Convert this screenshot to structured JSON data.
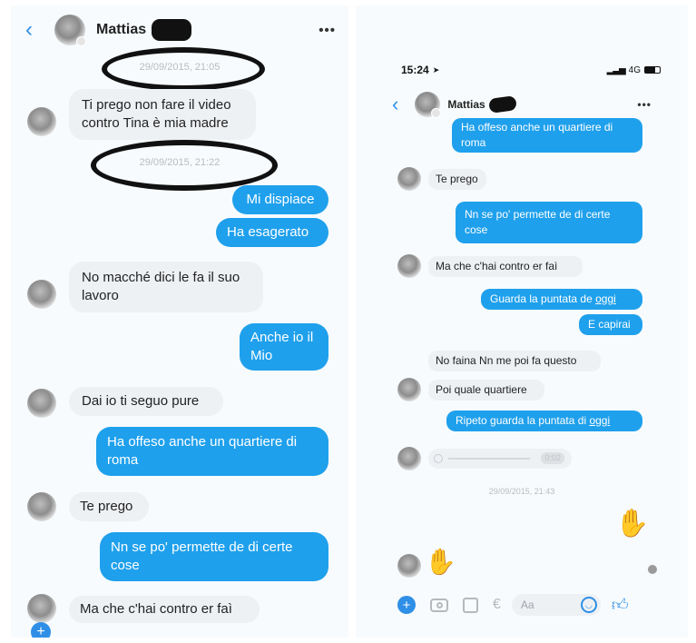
{
  "left": {
    "header": {
      "contact_name": "Mattias",
      "more_label": "•••"
    },
    "timestamps": [
      "29/09/2015, 21:05",
      "29/09/2015, 21:22"
    ],
    "messages": [
      "Ti prego non fare il video contro Tina è mia madre",
      "Mi dispiace",
      "Ha esagerato",
      "No macché dici le fa il suo lavoro",
      "Anche io il Mio",
      "Dai io ti seguo pure",
      "Ha offeso anche un quartiere di roma",
      "Te prego",
      "Nn se po' permette de di certe cose",
      "Ma che c'hai contro er faì"
    ]
  },
  "right": {
    "status_bar": {
      "time": "15:24",
      "network": "4G"
    },
    "header": {
      "contact_name": "Mattias",
      "more_label": "•••"
    },
    "messages": [
      "Ha offeso anche un quartiere di roma",
      "Te prego",
      "Nn se po' permette de di certe cose",
      "Ma che c'hai contro er faì",
      "Guarda la puntata de",
      "oggi",
      "E capirai",
      "No faina Nn me poi fa questo",
      "Poi quale quartiere",
      "Ripeto guarda la puntata di",
      "oggi"
    ],
    "voice_duration": "0:02",
    "timestamp": "29/09/2015, 21:43",
    "compose_placeholder": "Aa"
  },
  "colors": {
    "outgoing": "#1fa0ec",
    "incoming": "#eef1f4",
    "accent": "#2f8fe6"
  }
}
